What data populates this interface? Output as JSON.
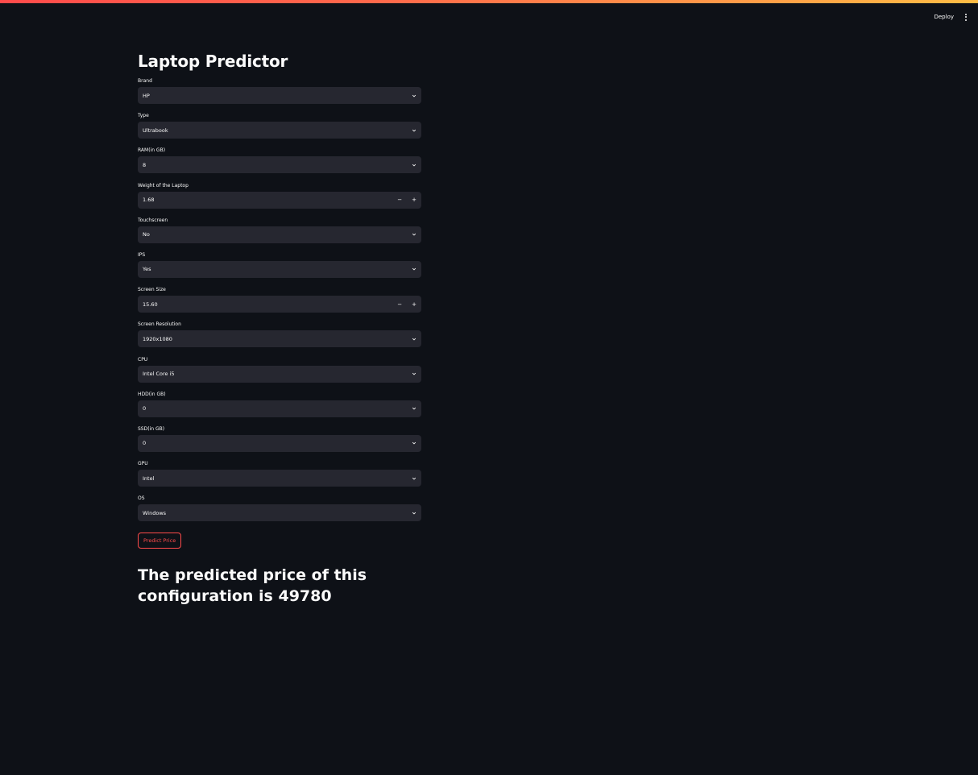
{
  "header": {
    "deploy_label": "Deploy"
  },
  "page": {
    "title": "Laptop Predictor"
  },
  "fields": [
    {
      "label": "Brand",
      "value": "HP",
      "kind": "select"
    },
    {
      "label": "Type",
      "value": "Ultrabook",
      "kind": "select"
    },
    {
      "label": "RAM(in GB)",
      "value": "8",
      "kind": "select"
    },
    {
      "label": "Weight of the Laptop",
      "value": "1.68",
      "kind": "number"
    },
    {
      "label": "Touchscreen",
      "value": "No",
      "kind": "select"
    },
    {
      "label": "IPS",
      "value": "Yes",
      "kind": "select"
    },
    {
      "label": "Screen Size",
      "value": "15.60",
      "kind": "number"
    },
    {
      "label": "Screen Resolution",
      "value": "1920x1080",
      "kind": "select"
    },
    {
      "label": "CPU",
      "value": "Intel Core i5",
      "kind": "select"
    },
    {
      "label": "HDD(in GB)",
      "value": "0",
      "kind": "select"
    },
    {
      "label": "SSD(in GB)",
      "value": "0",
      "kind": "select"
    },
    {
      "label": "GPU",
      "value": "Intel",
      "kind": "select"
    },
    {
      "label": "OS",
      "value": "Windows",
      "kind": "select"
    }
  ],
  "number_controls": {
    "minus": "−",
    "plus": "+"
  },
  "predict_button_label": "Predict Price",
  "result_text": "The predicted price of this configuration is 49780",
  "colors": {
    "background": "#0e1117",
    "input_bg": "#262730",
    "accent": "#ff4b4b"
  }
}
